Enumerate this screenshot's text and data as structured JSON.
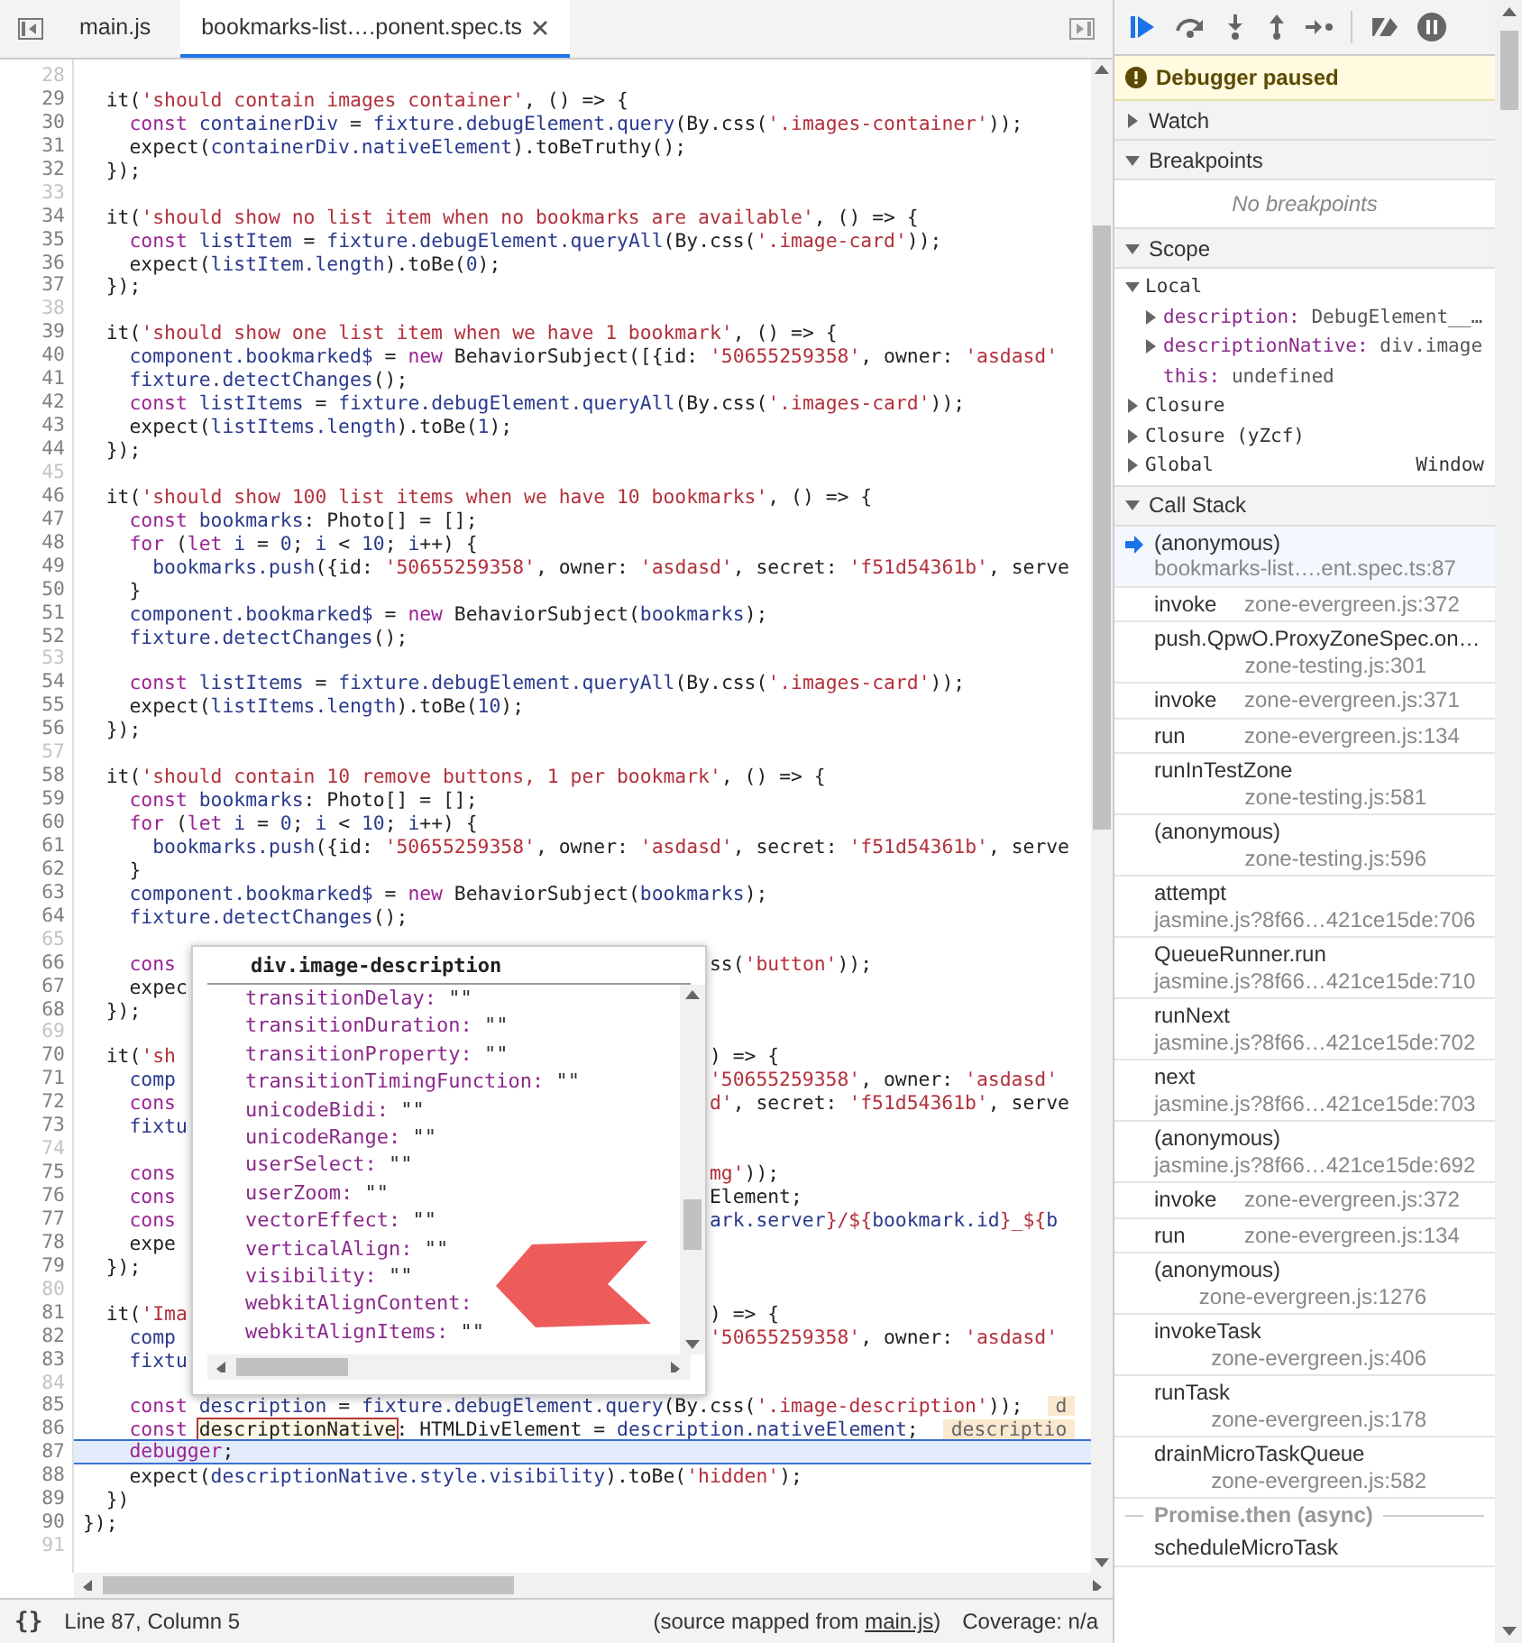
{
  "editor": {
    "tabs": [
      {
        "label": "main.js",
        "selected": false,
        "closable": false
      },
      {
        "label": "bookmarks-list….ponent.spec.ts",
        "selected": true,
        "closable": true
      }
    ],
    "lines": [
      {
        "number": "28",
        "current": false
      },
      {
        "number": "29",
        "current": false,
        "tokens": [
          {
            "kind": "p",
            "text": "  it("
          },
          {
            "kind": "s",
            "text": "'should contain images container'"
          },
          {
            "kind": "p",
            "text": ", () => {"
          }
        ]
      },
      {
        "number": "30",
        "current": false,
        "tokens": [
          {
            "kind": "k",
            "text": "    const"
          },
          {
            "kind": "v",
            "text": " containerDiv"
          },
          {
            "kind": "p",
            "text": " = "
          },
          {
            "kind": "v",
            "text": "fixture.debugElement.query"
          },
          {
            "kind": "p",
            "text": "(By.css("
          },
          {
            "kind": "s",
            "text": "'.images-container'"
          },
          {
            "kind": "p",
            "text": "));"
          }
        ]
      },
      {
        "number": "31",
        "current": false,
        "tokens": [
          {
            "kind": "p",
            "text": "    expect("
          },
          {
            "kind": "v",
            "text": "containerDiv.nativeElement"
          },
          {
            "kind": "p",
            "text": ").toBeTruthy();"
          }
        ]
      },
      {
        "number": "32",
        "current": false,
        "tokens": [
          {
            "kind": "p",
            "text": "  });"
          }
        ]
      },
      {
        "number": "33",
        "current": false
      },
      {
        "number": "34",
        "current": false,
        "tokens": [
          {
            "kind": "p",
            "text": "  it("
          },
          {
            "kind": "s",
            "text": "'should show no list item when no bookmarks are available'"
          },
          {
            "kind": "p",
            "text": ", () => {"
          }
        ]
      },
      {
        "number": "35",
        "current": false,
        "tokens": [
          {
            "kind": "k",
            "text": "    const"
          },
          {
            "kind": "v",
            "text": " listItem"
          },
          {
            "kind": "p",
            "text": " = "
          },
          {
            "kind": "v",
            "text": "fixture.debugElement.queryAll"
          },
          {
            "kind": "p",
            "text": "(By.css("
          },
          {
            "kind": "s",
            "text": "'.image-card'"
          },
          {
            "kind": "p",
            "text": "));"
          }
        ]
      },
      {
        "number": "36",
        "current": false,
        "tokens": [
          {
            "kind": "p",
            "text": "    expect("
          },
          {
            "kind": "v",
            "text": "listItem.length"
          },
          {
            "kind": "p",
            "text": ").toBe("
          },
          {
            "kind": "n",
            "text": "0"
          },
          {
            "kind": "p",
            "text": ");"
          }
        ]
      },
      {
        "number": "37",
        "current": false,
        "tokens": [
          {
            "kind": "p",
            "text": "  });"
          }
        ]
      },
      {
        "number": "38",
        "current": false
      },
      {
        "number": "39",
        "current": false,
        "tokens": [
          {
            "kind": "p",
            "text": "  it("
          },
          {
            "kind": "s",
            "text": "'should show one list item when we have 1 bookmark'"
          },
          {
            "kind": "p",
            "text": ", () => {"
          }
        ]
      },
      {
        "number": "40",
        "current": false,
        "tokens": [
          {
            "kind": "v",
            "text": "    component.bookmarked$"
          },
          {
            "kind": "p",
            "text": " = "
          },
          {
            "kind": "k",
            "text": "new"
          },
          {
            "kind": "p",
            "text": " BehaviorSubject([{id: "
          },
          {
            "kind": "s",
            "text": "'50655259358'"
          },
          {
            "kind": "p",
            "text": ", owner: "
          },
          {
            "kind": "s",
            "text": "'asdasd'"
          }
        ]
      },
      {
        "number": "41",
        "current": false,
        "tokens": [
          {
            "kind": "v",
            "text": "    fixture.detectChanges"
          },
          {
            "kind": "p",
            "text": "();"
          }
        ]
      },
      {
        "number": "42",
        "current": false,
        "tokens": [
          {
            "kind": "k",
            "text": "    const"
          },
          {
            "kind": "v",
            "text": " listItems"
          },
          {
            "kind": "p",
            "text": " = "
          },
          {
            "kind": "v",
            "text": "fixture.debugElement.queryAll"
          },
          {
            "kind": "p",
            "text": "(By.css("
          },
          {
            "kind": "s",
            "text": "'.images-card'"
          },
          {
            "kind": "p",
            "text": "));"
          }
        ]
      },
      {
        "number": "43",
        "current": false,
        "tokens": [
          {
            "kind": "p",
            "text": "    expect("
          },
          {
            "kind": "v",
            "text": "listItems.length"
          },
          {
            "kind": "p",
            "text": ").toBe("
          },
          {
            "kind": "n",
            "text": "1"
          },
          {
            "kind": "p",
            "text": ");"
          }
        ]
      },
      {
        "number": "44",
        "current": false,
        "tokens": [
          {
            "kind": "p",
            "text": "  });"
          }
        ]
      },
      {
        "number": "45",
        "current": false
      },
      {
        "number": "46",
        "current": false,
        "tokens": [
          {
            "kind": "p",
            "text": "  it("
          },
          {
            "kind": "s",
            "text": "'should show 100 list items when we have 10 bookmarks'"
          },
          {
            "kind": "p",
            "text": ", () => {"
          }
        ]
      },
      {
        "number": "47",
        "current": false,
        "tokens": [
          {
            "kind": "k",
            "text": "    const"
          },
          {
            "kind": "v",
            "text": " bookmarks"
          },
          {
            "kind": "p",
            "text": ": Photo[] = [];"
          }
        ]
      },
      {
        "number": "48",
        "current": false,
        "tokens": [
          {
            "kind": "k",
            "text": "    for"
          },
          {
            "kind": "p",
            "text": " ("
          },
          {
            "kind": "k",
            "text": "let"
          },
          {
            "kind": "v",
            "text": " i"
          },
          {
            "kind": "p",
            "text": " = "
          },
          {
            "kind": "n",
            "text": "0"
          },
          {
            "kind": "p",
            "text": "; "
          },
          {
            "kind": "v",
            "text": "i"
          },
          {
            "kind": "p",
            "text": " < "
          },
          {
            "kind": "n",
            "text": "10"
          },
          {
            "kind": "p",
            "text": "; "
          },
          {
            "kind": "v",
            "text": "i"
          },
          {
            "kind": "p",
            "text": "++) {"
          }
        ]
      },
      {
        "number": "49",
        "current": false,
        "tokens": [
          {
            "kind": "v",
            "text": "      bookmarks.push"
          },
          {
            "kind": "p",
            "text": "({id: "
          },
          {
            "kind": "s",
            "text": "'50655259358'"
          },
          {
            "kind": "p",
            "text": ", owner: "
          },
          {
            "kind": "s",
            "text": "'asdasd'"
          },
          {
            "kind": "p",
            "text": ", secret: "
          },
          {
            "kind": "s",
            "text": "'f51d54361b'"
          },
          {
            "kind": "p",
            "text": ", serve"
          }
        ]
      },
      {
        "number": "50",
        "current": false,
        "tokens": [
          {
            "kind": "p",
            "text": "    }"
          }
        ]
      },
      {
        "number": "51",
        "current": false,
        "tokens": [
          {
            "kind": "v",
            "text": "    component.bookmarked$"
          },
          {
            "kind": "p",
            "text": " = "
          },
          {
            "kind": "k",
            "text": "new"
          },
          {
            "kind": "p",
            "text": " BehaviorSubject("
          },
          {
            "kind": "v",
            "text": "bookmarks"
          },
          {
            "kind": "p",
            "text": ");"
          }
        ]
      },
      {
        "number": "52",
        "current": false,
        "tokens": [
          {
            "kind": "v",
            "text": "    fixture.detectChanges"
          },
          {
            "kind": "p",
            "text": "();"
          }
        ]
      },
      {
        "number": "53",
        "current": false
      },
      {
        "number": "54",
        "current": false,
        "tokens": [
          {
            "kind": "k",
            "text": "    const"
          },
          {
            "kind": "v",
            "text": " listItems"
          },
          {
            "kind": "p",
            "text": " = "
          },
          {
            "kind": "v",
            "text": "fixture.debugElement.queryAll"
          },
          {
            "kind": "p",
            "text": "(By.css("
          },
          {
            "kind": "s",
            "text": "'.images-card'"
          },
          {
            "kind": "p",
            "text": "));"
          }
        ]
      },
      {
        "number": "55",
        "current": false,
        "tokens": [
          {
            "kind": "p",
            "text": "    expect("
          },
          {
            "kind": "v",
            "text": "listItems.length"
          },
          {
            "kind": "p",
            "text": ").toBe("
          },
          {
            "kind": "n",
            "text": "10"
          },
          {
            "kind": "p",
            "text": ");"
          }
        ]
      },
      {
        "number": "56",
        "current": false,
        "tokens": [
          {
            "kind": "p",
            "text": "  });"
          }
        ]
      },
      {
        "number": "57",
        "current": false
      },
      {
        "number": "58",
        "current": false,
        "tokens": [
          {
            "kind": "p",
            "text": "  it("
          },
          {
            "kind": "s",
            "text": "'should contain 10 remove buttons, 1 per bookmark'"
          },
          {
            "kind": "p",
            "text": ", () => {"
          }
        ]
      },
      {
        "number": "59",
        "current": false,
        "tokens": [
          {
            "kind": "k",
            "text": "    const"
          },
          {
            "kind": "v",
            "text": " bookmarks"
          },
          {
            "kind": "p",
            "text": ": Photo[] = [];"
          }
        ]
      },
      {
        "number": "60",
        "current": false,
        "tokens": [
          {
            "kind": "k",
            "text": "    for"
          },
          {
            "kind": "p",
            "text": " ("
          },
          {
            "kind": "k",
            "text": "let"
          },
          {
            "kind": "v",
            "text": " i"
          },
          {
            "kind": "p",
            "text": " = "
          },
          {
            "kind": "n",
            "text": "0"
          },
          {
            "kind": "p",
            "text": "; "
          },
          {
            "kind": "v",
            "text": "i"
          },
          {
            "kind": "p",
            "text": " < "
          },
          {
            "kind": "n",
            "text": "10"
          },
          {
            "kind": "p",
            "text": "; "
          },
          {
            "kind": "v",
            "text": "i"
          },
          {
            "kind": "p",
            "text": "++) {"
          }
        ]
      },
      {
        "number": "61",
        "current": false,
        "tokens": [
          {
            "kind": "v",
            "text": "      bookmarks.push"
          },
          {
            "kind": "p",
            "text": "({id: "
          },
          {
            "kind": "s",
            "text": "'50655259358'"
          },
          {
            "kind": "p",
            "text": ", owner: "
          },
          {
            "kind": "s",
            "text": "'asdasd'"
          },
          {
            "kind": "p",
            "text": ", secret: "
          },
          {
            "kind": "s",
            "text": "'f51d54361b'"
          },
          {
            "kind": "p",
            "text": ", serve"
          }
        ]
      },
      {
        "number": "62",
        "current": false,
        "tokens": [
          {
            "kind": "p",
            "text": "    }"
          }
        ]
      },
      {
        "number": "63",
        "current": false,
        "tokens": [
          {
            "kind": "v",
            "text": "    component.bookmarked$"
          },
          {
            "kind": "p",
            "text": " = "
          },
          {
            "kind": "k",
            "text": "new"
          },
          {
            "kind": "p",
            "text": " BehaviorSubject("
          },
          {
            "kind": "v",
            "text": "bookmarks"
          },
          {
            "kind": "p",
            "text": ");"
          }
        ]
      },
      {
        "number": "64",
        "current": false,
        "tokens": [
          {
            "kind": "v",
            "text": "    fixture.detectChanges"
          },
          {
            "kind": "p",
            "text": "();"
          }
        ]
      },
      {
        "number": "65",
        "current": false
      },
      {
        "number": "66",
        "current": false,
        "left": [
          {
            "kind": "k",
            "text": "    cons"
          }
        ],
        "right": [
          {
            "kind": "p",
            "text": "ss("
          },
          {
            "kind": "s",
            "text": "'button'"
          },
          {
            "kind": "p",
            "text": "));"
          }
        ]
      },
      {
        "number": "67",
        "current": false,
        "left": [
          {
            "kind": "p",
            "text": "    expec"
          }
        ]
      },
      {
        "number": "68",
        "current": false,
        "left": [
          {
            "kind": "p",
            "text": "  });"
          }
        ]
      },
      {
        "number": "69",
        "current": false
      },
      {
        "number": "70",
        "current": false,
        "left": [
          {
            "kind": "p",
            "text": "  it("
          },
          {
            "kind": "s",
            "text": "'sh"
          }
        ],
        "right": [
          {
            "kind": "p",
            "text": ") => {"
          }
        ]
      },
      {
        "number": "71",
        "current": false,
        "left": [
          {
            "kind": "v",
            "text": "    comp"
          }
        ],
        "right": [
          {
            "kind": "s",
            "text": "'50655259358'"
          },
          {
            "kind": "p",
            "text": ", owner: "
          },
          {
            "kind": "s",
            "text": "'asdasd'"
          }
        ]
      },
      {
        "number": "72",
        "current": false,
        "left": [
          {
            "kind": "k",
            "text": "    cons"
          }
        ],
        "right": [
          {
            "kind": "s",
            "text": "d'"
          },
          {
            "kind": "p",
            "text": ", secret: "
          },
          {
            "kind": "s",
            "text": "'f51d54361b'"
          },
          {
            "kind": "p",
            "text": ", serve"
          }
        ]
      },
      {
        "number": "73",
        "current": false,
        "left": [
          {
            "kind": "v",
            "text": "    fixtu"
          }
        ]
      },
      {
        "number": "74",
        "current": false
      },
      {
        "number": "75",
        "current": false,
        "left": [
          {
            "kind": "k",
            "text": "    cons"
          }
        ],
        "right": [
          {
            "kind": "s",
            "text": "mg'"
          },
          {
            "kind": "p",
            "text": "));"
          }
        ]
      },
      {
        "number": "76",
        "current": false,
        "left": [
          {
            "kind": "k",
            "text": "    cons"
          }
        ],
        "right": [
          {
            "kind": "p",
            "text": "Element;"
          }
        ]
      },
      {
        "number": "77",
        "current": false,
        "left": [
          {
            "kind": "k",
            "text": "    cons"
          }
        ],
        "right": [
          {
            "kind": "v",
            "text": "ark.server"
          },
          {
            "kind": "s",
            "text": "}/${"
          },
          {
            "kind": "v",
            "text": "bookmark.id"
          },
          {
            "kind": "s",
            "text": "}_${"
          },
          {
            "kind": "v",
            "text": "b"
          }
        ]
      },
      {
        "number": "78",
        "current": false,
        "left": [
          {
            "kind": "p",
            "text": "    expe"
          }
        ]
      },
      {
        "number": "79",
        "current": false,
        "left": [
          {
            "kind": "p",
            "text": "  });"
          }
        ]
      },
      {
        "number": "80",
        "current": false
      },
      {
        "number": "81",
        "current": false,
        "left": [
          {
            "kind": "p",
            "text": "  it("
          },
          {
            "kind": "s",
            "text": "'Ima"
          }
        ],
        "right": [
          {
            "kind": "p",
            "text": ") => {"
          }
        ]
      },
      {
        "number": "82",
        "current": false,
        "left": [
          {
            "kind": "v",
            "text": "    comp"
          }
        ],
        "right": [
          {
            "kind": "s",
            "text": "'50655259358'"
          },
          {
            "kind": "p",
            "text": ", owner: "
          },
          {
            "kind": "s",
            "text": "'asdasd'"
          }
        ]
      },
      {
        "number": "83",
        "current": false,
        "left": [
          {
            "kind": "v",
            "text": "    fixtu"
          }
        ]
      },
      {
        "number": "84",
        "current": false
      },
      {
        "number": "85",
        "current": false,
        "tokens": [
          {
            "kind": "k",
            "text": "    const"
          },
          {
            "kind": "v",
            "text": " description"
          },
          {
            "kind": "p",
            "text": " = "
          },
          {
            "kind": "v",
            "text": "fixture.debugElement.query"
          },
          {
            "kind": "p",
            "text": "(By.css("
          },
          {
            "kind": "s",
            "text": "'.image-description'"
          },
          {
            "kind": "p",
            "text": "));"
          }
        ],
        "inline_value": "d"
      },
      {
        "number": "86",
        "current": false,
        "tokens": [
          {
            "kind": "k",
            "text": "    const "
          },
          {
            "kind": "hv",
            "text": "descriptionNative"
          },
          {
            "kind": "p",
            "text": ": HTMLDivElement = "
          },
          {
            "kind": "v",
            "text": "description.nativeElement"
          },
          {
            "kind": "p",
            "text": ";"
          }
        ],
        "inline_value": "descriptio"
      },
      {
        "number": "87",
        "current": true,
        "tokens": [
          {
            "kind": "k",
            "text": "    debugger"
          },
          {
            "kind": "p",
            "text": ";"
          }
        ]
      },
      {
        "number": "88",
        "current": false,
        "tokens": [
          {
            "kind": "p",
            "text": "    expect("
          },
          {
            "kind": "v",
            "text": "descriptionNative.style.visibility"
          },
          {
            "kind": "p",
            "text": ").toBe("
          },
          {
            "kind": "s",
            "text": "'hidden'"
          },
          {
            "kind": "p",
            "text": ");"
          }
        ]
      },
      {
        "number": "89",
        "current": false,
        "tokens": [
          {
            "kind": "p",
            "text": "  })"
          }
        ]
      },
      {
        "number": "90",
        "current": false,
        "tokens": [
          {
            "kind": "p",
            "text": "});"
          }
        ]
      },
      {
        "number": "91",
        "current": false
      }
    ],
    "popup": {
      "title": "div.image-description",
      "properties": [
        {
          "name": "transitionDelay:",
          "value": "\"\""
        },
        {
          "name": "transitionDuration:",
          "value": "\"\""
        },
        {
          "name": "transitionProperty:",
          "value": "\"\""
        },
        {
          "name": "transitionTimingFunction:",
          "value": "\"\""
        },
        {
          "name": "unicodeBidi:",
          "value": "\"\""
        },
        {
          "name": "unicodeRange:",
          "value": "\"\""
        },
        {
          "name": "userSelect:",
          "value": "\"\""
        },
        {
          "name": "userZoom:",
          "value": "\"\""
        },
        {
          "name": "vectorEffect:",
          "value": "\"\""
        },
        {
          "name": "verticalAlign:",
          "value": "\"\""
        },
        {
          "name": "visibility:",
          "value": "\"\""
        },
        {
          "name": "webkitAlignContent:"
        },
        {
          "name": "webkitAlignItems:",
          "value": "\"\""
        }
      ]
    },
    "status_bar": {
      "format_button": "{}",
      "position": "Line 87, Column 5",
      "source_prefix": "(source mapped from ",
      "source_link": "main.js",
      "source_suffix": ")",
      "coverage": "Coverage: n/a"
    }
  },
  "debugger": {
    "banner": "Debugger paused",
    "sections": [
      {
        "kind": "watch",
        "title": "Watch",
        "expanded": false
      },
      {
        "kind": "breakpoints",
        "title": "Breakpoints",
        "expanded": true,
        "empty_text": "No breakpoints"
      },
      {
        "kind": "scope",
        "title": "Scope",
        "expanded": true,
        "scopes": [
          {
            "name": "Local",
            "expanded": true,
            "vars": [
              {
                "name": "description:",
                "value": "DebugElement__…",
                "expandable": true
              },
              {
                "name": "descriptionNative:",
                "value": "div.image",
                "expandable": true
              },
              {
                "name": "this:",
                "value": "undefined",
                "expandable": false
              }
            ]
          },
          {
            "name": "Closure",
            "expanded": false
          },
          {
            "name": "Closure (yZcf)",
            "expanded": false
          },
          {
            "name": "Global",
            "expanded": false,
            "value": "Window"
          }
        ]
      },
      {
        "kind": "callstack",
        "title": "Call Stack",
        "expanded": true,
        "frames": [
          {
            "kind": "stacked",
            "name": "(anonymous)",
            "location": "bookmarks-list….ent.spec.ts:87",
            "selected": true
          },
          {
            "kind": "inline",
            "name": "invoke",
            "location": "zone-evergreen.js:372",
            "selected": false
          },
          {
            "kind": "stacked",
            "name": "push.QpwO.ProxyZoneSpec.on…",
            "location": "zone-testing.js:301",
            "selected": false
          },
          {
            "kind": "inline",
            "name": "invoke",
            "location": "zone-evergreen.js:371",
            "selected": false
          },
          {
            "kind": "inline",
            "name": "run",
            "location": "zone-evergreen.js:134",
            "selected": false
          },
          {
            "kind": "stacked",
            "name": "runInTestZone",
            "location": "zone-testing.js:581",
            "selected": false
          },
          {
            "kind": "stacked",
            "name": "(anonymous)",
            "location": "zone-testing.js:596",
            "selected": false
          },
          {
            "kind": "stacked",
            "name": "attempt",
            "location": "jasmine.js?8f66…421ce15de:706",
            "selected": false
          },
          {
            "kind": "stacked",
            "name": "QueueRunner.run",
            "location": "jasmine.js?8f66…421ce15de:710",
            "selected": false
          },
          {
            "kind": "stacked",
            "name": "runNext",
            "location": "jasmine.js?8f66…421ce15de:702",
            "selected": false
          },
          {
            "kind": "stacked",
            "name": "next",
            "location": "jasmine.js?8f66…421ce15de:703",
            "selected": false
          },
          {
            "kind": "stacked",
            "name": "(anonymous)",
            "location": "jasmine.js?8f66…421ce15de:692",
            "selected": false
          },
          {
            "kind": "inline",
            "name": "invoke",
            "location": "zone-evergreen.js:372",
            "selected": false
          },
          {
            "kind": "inline",
            "name": "run",
            "location": "zone-evergreen.js:134",
            "selected": false
          },
          {
            "kind": "stacked",
            "name": "(anonymous)",
            "location": "zone-evergreen.js:1276",
            "selected": false
          },
          {
            "kind": "stacked",
            "name": "invokeTask",
            "location": "zone-evergreen.js:406",
            "selected": false
          },
          {
            "kind": "stacked",
            "name": "runTask",
            "location": "zone-evergreen.js:178",
            "selected": false
          },
          {
            "kind": "stacked",
            "name": "drainMicroTaskQueue",
            "location": "zone-evergreen.js:582",
            "selected": false
          }
        ],
        "async_label": "Promise.then (async)",
        "async_frames": [
          {
            "name": "scheduleMicroTask"
          }
        ]
      }
    ]
  }
}
